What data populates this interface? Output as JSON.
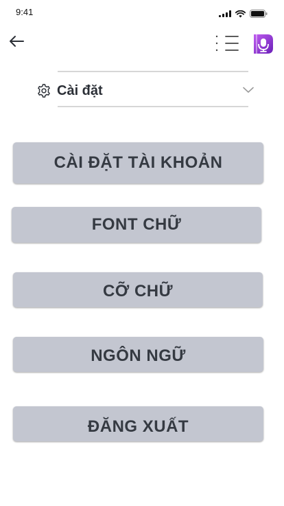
{
  "status_bar": {
    "time": "9:41"
  },
  "header": {
    "back_icon": "arrow-left-icon",
    "menu_icon": "list-menu-icon",
    "logo_icon": "app-logo-icon"
  },
  "settings_dropdown": {
    "label": "Cài đặt",
    "icon": "gear-icon",
    "chevron": "chevron-down-icon"
  },
  "menu": {
    "items": [
      {
        "label": "CÀI ĐẶT TÀI KHOẢN"
      },
      {
        "label": "FONT CHỮ"
      },
      {
        "label": "CỠ CHỮ"
      },
      {
        "label": "NGÔN NGỮ"
      },
      {
        "label": "ĐĂNG XUẤT"
      }
    ]
  },
  "colors": {
    "button_bg": "#c3c6d0",
    "button_text": "#353a42",
    "logo_purple": "#8e2bd6"
  }
}
